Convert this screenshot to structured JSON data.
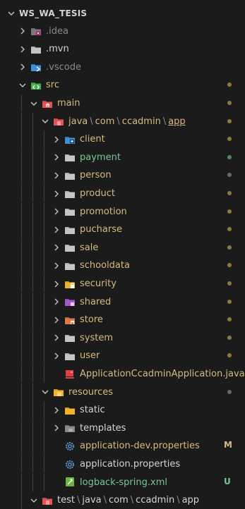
{
  "explorer": {
    "root_label": "WS_WA_TESIS",
    "rows": [
      {
        "label": "WS_WA_TESIS",
        "depth": 0,
        "chevron": "down",
        "icon": "none",
        "color": "white",
        "root": true
      },
      {
        "label": ".idea",
        "depth": 1,
        "chevron": "right",
        "icon": "idea-folder-icon",
        "color": "dim"
      },
      {
        "label": ".mvn",
        "depth": 1,
        "chevron": "right",
        "icon": "folder-icon",
        "color": "white"
      },
      {
        "label": ".vscode",
        "depth": 1,
        "chevron": "right",
        "icon": "vscode-folder-icon",
        "color": "dim"
      },
      {
        "label": "src",
        "depth": 1,
        "chevron": "down",
        "icon": "src-folder-icon",
        "color": "yellow",
        "status": "dot-yellow"
      },
      {
        "label": "main",
        "depth": 2,
        "chevron": "down",
        "icon": "main-folder-icon",
        "color": "yellow",
        "status": "dot-yellow"
      },
      {
        "label": "java\\com\\ccadmin\\app",
        "depth": 3,
        "chevron": "down",
        "icon": "java-folder-icon",
        "color": "yellow",
        "status": "dot-yellow",
        "path": [
          "java",
          "com",
          "ccadmin",
          "app"
        ]
      },
      {
        "label": "client",
        "depth": 4,
        "chevron": "right",
        "icon": "client-folder-icon",
        "color": "yellow",
        "status": "dot-yellow"
      },
      {
        "label": "payment",
        "depth": 4,
        "chevron": "right",
        "icon": "folder-icon",
        "color": "green",
        "status": "dot-green"
      },
      {
        "label": "person",
        "depth": 4,
        "chevron": "right",
        "icon": "folder-icon",
        "color": "yellow",
        "status": "dot-grey"
      },
      {
        "label": "product",
        "depth": 4,
        "chevron": "right",
        "icon": "folder-icon",
        "color": "yellow",
        "status": "dot-yellow"
      },
      {
        "label": "promotion",
        "depth": 4,
        "chevron": "right",
        "icon": "folder-icon",
        "color": "yellow",
        "status": "dot-yellow"
      },
      {
        "label": "pucharse",
        "depth": 4,
        "chevron": "right",
        "icon": "folder-icon",
        "color": "yellow",
        "status": "dot-yellow"
      },
      {
        "label": "sale",
        "depth": 4,
        "chevron": "right",
        "icon": "folder-icon",
        "color": "yellow",
        "status": "dot-yellow"
      },
      {
        "label": "schooldata",
        "depth": 4,
        "chevron": "right",
        "icon": "folder-icon",
        "color": "yellow",
        "status": "dot-yellow"
      },
      {
        "label": "security",
        "depth": 4,
        "chevron": "right",
        "icon": "security-folder-icon",
        "color": "yellow",
        "status": "dot-yellow"
      },
      {
        "label": "shared",
        "depth": 4,
        "chevron": "right",
        "icon": "shared-folder-icon",
        "color": "yellow",
        "status": "dot-yellow"
      },
      {
        "label": "store",
        "depth": 4,
        "chevron": "right",
        "icon": "store-folder-icon",
        "color": "yellow",
        "status": "dot-yellow"
      },
      {
        "label": "system",
        "depth": 4,
        "chevron": "right",
        "icon": "folder-icon",
        "color": "yellow",
        "status": "dot-yellow"
      },
      {
        "label": "user",
        "depth": 4,
        "chevron": "right",
        "icon": "folder-icon",
        "color": "yellow",
        "status": "dot-yellow"
      },
      {
        "label": "ApplicationCcadminApplication.java",
        "depth": 4,
        "chevron": "none",
        "icon": "java-file-icon",
        "color": "yellow"
      },
      {
        "label": "resources",
        "depth": 3,
        "chevron": "down",
        "icon": "resources-folder-icon",
        "color": "yellow",
        "status": "dot-grey"
      },
      {
        "label": "static",
        "depth": 4,
        "chevron": "right",
        "icon": "static-folder-icon",
        "color": "white"
      },
      {
        "label": "templates",
        "depth": 4,
        "chevron": "right",
        "icon": "templates-folder-icon",
        "color": "white"
      },
      {
        "label": "application-dev.properties",
        "depth": 4,
        "chevron": "none",
        "icon": "gear-icon",
        "color": "yellow",
        "badge": "M"
      },
      {
        "label": "application.properties",
        "depth": 4,
        "chevron": "none",
        "icon": "gear-icon",
        "color": "white"
      },
      {
        "label": "logback-spring.xml",
        "depth": 4,
        "chevron": "none",
        "icon": "xml-file-icon",
        "color": "green",
        "badge": "U"
      },
      {
        "label": "test\\java\\com\\ccadmin\\app",
        "depth": 2,
        "chevron": "down",
        "icon": "java-folder-icon",
        "color": "white",
        "path": [
          "test",
          "java",
          "com",
          "ccadmin",
          "app"
        ]
      }
    ]
  },
  "colors": {
    "background": "#1b1b1b",
    "modified": "#d7ba7d",
    "untracked": "#73c991",
    "default_text": "#d4d4d4"
  }
}
